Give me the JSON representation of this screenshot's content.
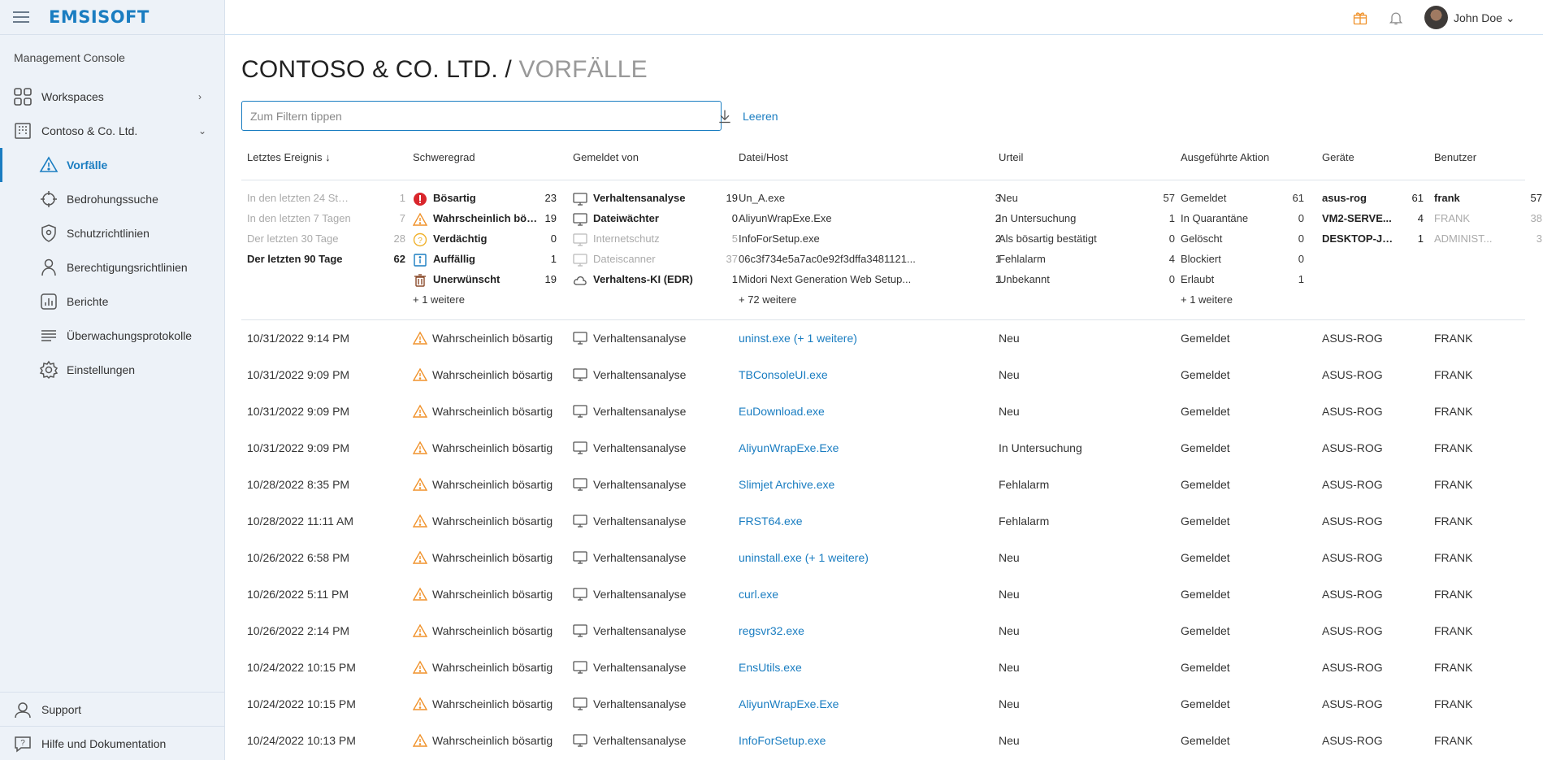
{
  "app": {
    "logo": "EMSISOFT",
    "console_title": "Management Console"
  },
  "nav": {
    "workspaces": "Workspaces",
    "org": "Contoso & Co. Ltd.",
    "items": [
      "Vorfälle",
      "Bedrohungssuche",
      "Schutzrichtlinien",
      "Berechtigungsrichtlinien",
      "Berichte",
      "Überwachungsprotokolle",
      "Einstellungen"
    ],
    "support": "Support",
    "help": "Hilfe und Dokumentation"
  },
  "topbar": {
    "user": "John Doe",
    "user_chevron": "⌄"
  },
  "page": {
    "title_main": "CONTOSO & CO. LTD. / ",
    "title_sub": "VORFÄLLE",
    "filter_placeholder": "Zum Filtern tippen",
    "clear_label": "Leeren"
  },
  "columns": {
    "last_event": "Letztes Ereignis",
    "sort_arrow": "↓",
    "severity": "Schweregrad",
    "reported_by": "Gemeldet von",
    "file_host": "Datei/Host",
    "verdict": "Urteil",
    "action": "Ausgeführte Aktion",
    "devices": "Geräte",
    "users": "Benutzer"
  },
  "facets": {
    "time": [
      {
        "label": "In den letzten 24 Stu...",
        "count": "1"
      },
      {
        "label": "In den letzten 7 Tagen",
        "count": "7"
      },
      {
        "label": "Der letzten 30 Tage",
        "count": "28"
      },
      {
        "label": "Der letzten 90 Tage",
        "count": "62"
      }
    ],
    "severity": [
      {
        "label": "Bösartig",
        "count": "23"
      },
      {
        "label": "Wahrscheinlich bös...",
        "count": "19"
      },
      {
        "label": "Verdächtig",
        "count": "0"
      },
      {
        "label": "Auffällig",
        "count": "1"
      },
      {
        "label": "Unerwünscht",
        "count": "19"
      }
    ],
    "severity_more": "+ 1 weitere",
    "reporter": [
      {
        "label": "Verhaltensanalyse",
        "count": "19"
      },
      {
        "label": "Dateiwächter",
        "count": "0"
      },
      {
        "label": "Internetschutz",
        "count": "5"
      },
      {
        "label": "Dateiscanner",
        "count": "37"
      },
      {
        "label": "Verhaltens-KI (EDR)",
        "count": "1"
      }
    ],
    "file": [
      {
        "label": "Un_A.exe",
        "count": "3"
      },
      {
        "label": "AliyunWrapExe.Exe",
        "count": "2"
      },
      {
        "label": "InfoForSetup.exe",
        "count": "2"
      },
      {
        "label": "06c3f734e5a7ac0e92f3dffa3481121...",
        "count": "1"
      },
      {
        "label": "Midori Next Generation Web Setup...",
        "count": "1"
      }
    ],
    "file_more": "+ 72 weitere",
    "verdict": [
      {
        "label": "Neu",
        "count": "57"
      },
      {
        "label": "In Untersuchung",
        "count": "1"
      },
      {
        "label": "Als bösartig bestätigt",
        "count": "0"
      },
      {
        "label": "Fehlalarm",
        "count": "4"
      },
      {
        "label": "Unbekannt",
        "count": "0"
      }
    ],
    "action": [
      {
        "label": "Gemeldet",
        "count": "61"
      },
      {
        "label": "In Quarantäne",
        "count": "0"
      },
      {
        "label": "Gelöscht",
        "count": "0"
      },
      {
        "label": "Blockiert",
        "count": "0"
      },
      {
        "label": "Erlaubt",
        "count": "1"
      }
    ],
    "action_more": "+ 1 weitere",
    "devices": [
      {
        "label": "asus-rog",
        "count": "61"
      },
      {
        "label": "VM2-SERVE...",
        "count": "4"
      },
      {
        "label": "DESKTOP-JH...",
        "count": "1"
      }
    ],
    "users": [
      {
        "label": "frank",
        "count": "57"
      },
      {
        "label": "FRANK",
        "count": "38"
      },
      {
        "label": "ADMINIST...",
        "count": "3"
      }
    ]
  },
  "rows": [
    {
      "date": "10/31/2022 9:14 PM",
      "severity": "Wahrscheinlich bösartig",
      "reporter": "Verhaltensanalyse",
      "file": "uninst.exe",
      "file_extra": " (+ 1 weitere)",
      "verdict": "Neu",
      "action": "Gemeldet",
      "device": "ASUS-ROG",
      "user": "FRANK"
    },
    {
      "date": "10/31/2022 9:09 PM",
      "severity": "Wahrscheinlich bösartig",
      "reporter": "Verhaltensanalyse",
      "file": "TBConsoleUI.exe",
      "file_extra": "",
      "verdict": "Neu",
      "action": "Gemeldet",
      "device": "ASUS-ROG",
      "user": "FRANK"
    },
    {
      "date": "10/31/2022 9:09 PM",
      "severity": "Wahrscheinlich bösartig",
      "reporter": "Verhaltensanalyse",
      "file": "EuDownload.exe",
      "file_extra": "",
      "verdict": "Neu",
      "action": "Gemeldet",
      "device": "ASUS-ROG",
      "user": "FRANK"
    },
    {
      "date": "10/31/2022 9:09 PM",
      "severity": "Wahrscheinlich bösartig",
      "reporter": "Verhaltensanalyse",
      "file": "AliyunWrapExe.Exe",
      "file_extra": "",
      "verdict": "In Untersuchung",
      "action": "Gemeldet",
      "device": "ASUS-ROG",
      "user": "FRANK"
    },
    {
      "date": "10/28/2022 8:35 PM",
      "severity": "Wahrscheinlich bösartig",
      "reporter": "Verhaltensanalyse",
      "file": "Slimjet Archive.exe",
      "file_extra": "",
      "verdict": "Fehlalarm",
      "action": "Gemeldet",
      "device": "ASUS-ROG",
      "user": "FRANK"
    },
    {
      "date": "10/28/2022 11:11 AM",
      "severity": "Wahrscheinlich bösartig",
      "reporter": "Verhaltensanalyse",
      "file": "FRST64.exe",
      "file_extra": "",
      "verdict": "Fehlalarm",
      "action": "Gemeldet",
      "device": "ASUS-ROG",
      "user": "FRANK"
    },
    {
      "date": "10/26/2022 6:58 PM",
      "severity": "Wahrscheinlich bösartig",
      "reporter": "Verhaltensanalyse",
      "file": "uninstall.exe",
      "file_extra": " (+ 1 weitere)",
      "verdict": "Neu",
      "action": "Gemeldet",
      "device": "ASUS-ROG",
      "user": "FRANK"
    },
    {
      "date": "10/26/2022 5:11 PM",
      "severity": "Wahrscheinlich bösartig",
      "reporter": "Verhaltensanalyse",
      "file": "curl.exe",
      "file_extra": "",
      "verdict": "Neu",
      "action": "Gemeldet",
      "device": "ASUS-ROG",
      "user": "FRANK"
    },
    {
      "date": "10/26/2022 2:14 PM",
      "severity": "Wahrscheinlich bösartig",
      "reporter": "Verhaltensanalyse",
      "file": "regsvr32.exe",
      "file_extra": "",
      "verdict": "Neu",
      "action": "Gemeldet",
      "device": "ASUS-ROG",
      "user": "FRANK"
    },
    {
      "date": "10/24/2022 10:15 PM",
      "severity": "Wahrscheinlich bösartig",
      "reporter": "Verhaltensanalyse",
      "file": "EnsUtils.exe",
      "file_extra": "",
      "verdict": "Neu",
      "action": "Gemeldet",
      "device": "ASUS-ROG",
      "user": "FRANK"
    },
    {
      "date": "10/24/2022 10:15 PM",
      "severity": "Wahrscheinlich bösartig",
      "reporter": "Verhaltensanalyse",
      "file": "AliyunWrapExe.Exe",
      "file_extra": "",
      "verdict": "Neu",
      "action": "Gemeldet",
      "device": "ASUS-ROG",
      "user": "FRANK"
    },
    {
      "date": "10/24/2022 10:13 PM",
      "severity": "Wahrscheinlich bösartig",
      "reporter": "Verhaltensanalyse",
      "file": "InfoForSetup.exe",
      "file_extra": "",
      "verdict": "Neu",
      "action": "Gemeldet",
      "device": "ASUS-ROG",
      "user": "FRANK"
    }
  ],
  "colors": {
    "accent": "#1a7dc1",
    "warning": "#f0922b",
    "danger": "#d9262c",
    "sidebar_bg": "#edf2f8"
  }
}
